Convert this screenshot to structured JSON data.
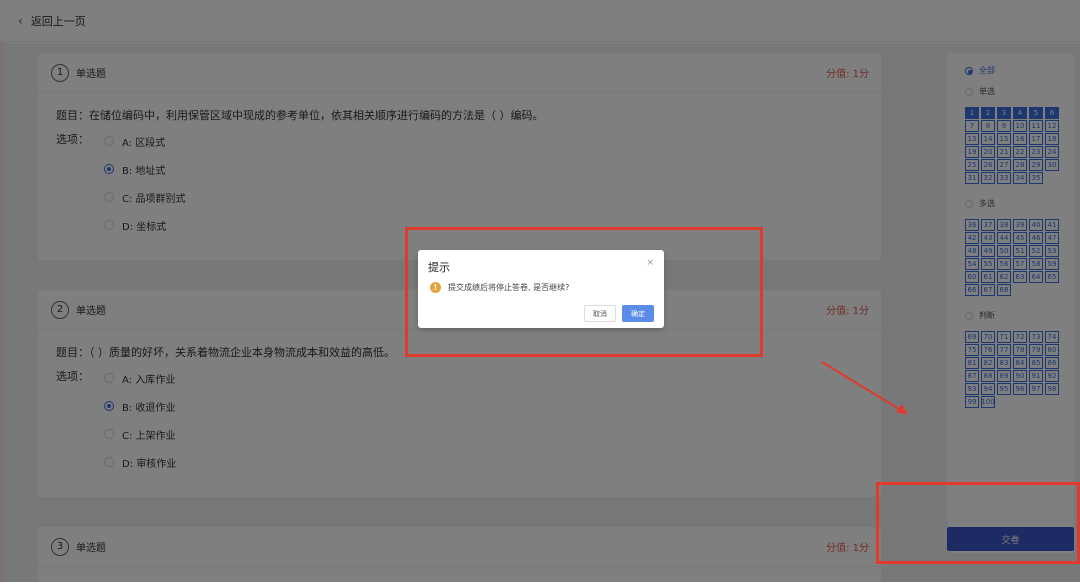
{
  "topbar": {
    "back_label": "返回上一页"
  },
  "questions": [
    {
      "num": "1",
      "type": "单选题",
      "score": "分值: 1分",
      "text": "题目：在储位编码中，利用保管区域中现成的参考单位，依其相关顺序进行编码的方法是（ ）编码。",
      "options_label": "选项：",
      "options": [
        "A: 区段式",
        "B: 地址式",
        "C: 品项群别式",
        "D: 坐标式"
      ]
    },
    {
      "num": "2",
      "type": "单选题",
      "score": "分值: 1分",
      "text": "题目：（ ）质量的好坏，关系着物流企业本身物流成本和效益的高低。",
      "options_label": "选项：",
      "options": [
        "A: 入库作业",
        "B: 收退作业",
        "C: 上架作业",
        "D: 审核作业"
      ]
    },
    {
      "num": "3",
      "type": "单选题",
      "score": "分值: 1分"
    }
  ],
  "panel": {
    "seg_all": "全部",
    "seg_single": "单选",
    "seg_multi": "多选",
    "seg_judge": "判断",
    "single_nums": [
      "1",
      "2",
      "3",
      "4",
      "5",
      "6",
      "7",
      "8",
      "9",
      "10",
      "11",
      "12",
      "13",
      "14",
      "15",
      "16",
      "17",
      "18",
      "19",
      "20",
      "21",
      "22",
      "23",
      "24",
      "25",
      "26",
      "27",
      "28",
      "29",
      "30",
      "31",
      "32",
      "33",
      "34",
      "35"
    ],
    "multi_nums": [
      "36",
      "37",
      "38",
      "39",
      "40",
      "41",
      "42",
      "43",
      "44",
      "45",
      "46",
      "47",
      "48",
      "49",
      "50",
      "51",
      "52",
      "53",
      "54",
      "55",
      "56",
      "57",
      "58",
      "59",
      "60",
      "61",
      "62",
      "63",
      "64",
      "65",
      "66",
      "67",
      "68"
    ],
    "judge_nums": [
      "69",
      "70",
      "71",
      "72",
      "73",
      "74",
      "75",
      "76",
      "77",
      "78",
      "79",
      "80",
      "81",
      "82",
      "83",
      "84",
      "85",
      "86",
      "87",
      "88",
      "89",
      "90",
      "91",
      "92",
      "93",
      "94",
      "95",
      "96",
      "97",
      "98",
      "99",
      "100"
    ],
    "answered_count": 6,
    "submit_label": "交卷"
  },
  "dialog": {
    "title": "提示",
    "close": "×",
    "message": "提交成绩后将停止答卷, 是否继续?",
    "cancel": "取消",
    "ok": "确定"
  },
  "colors": {
    "accent": "#3b6fe0",
    "score": "#e0564c",
    "highlight": "#e03a2f"
  }
}
